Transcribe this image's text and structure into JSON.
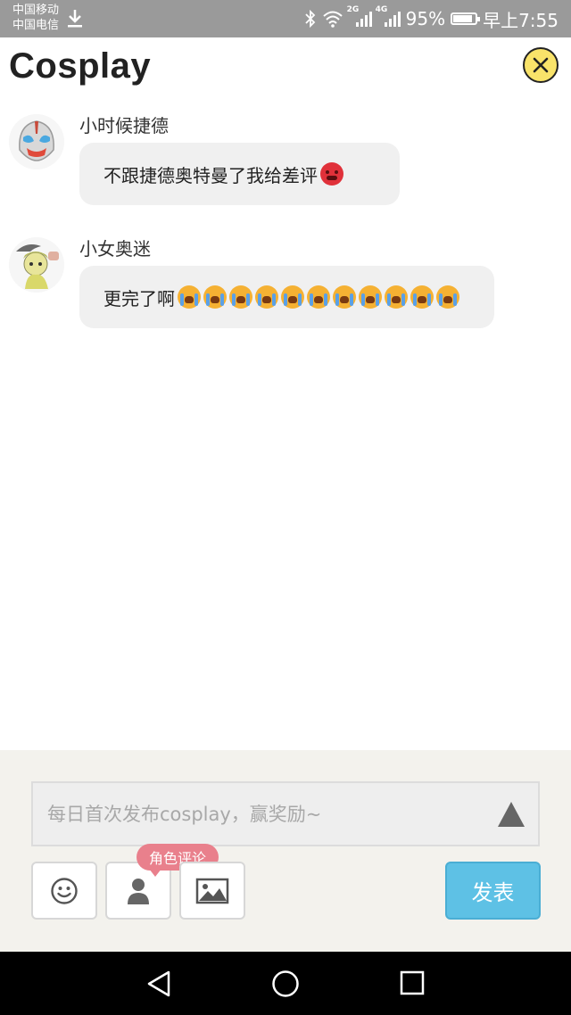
{
  "status_bar": {
    "carrier_1": "中国移动",
    "carrier_2": "中国电信",
    "net_1": "2G",
    "net_2": "4G",
    "battery_percent": "95%",
    "battery_level": 0.95,
    "time": "早上7:55"
  },
  "header": {
    "title": "Cosplay",
    "close_icon": "close-icon"
  },
  "messages": [
    {
      "username": "小时候捷德",
      "text": "不跟捷德奥特曼了我给差评",
      "emojis": [
        "angry-face"
      ]
    },
    {
      "username": "小女奥迷",
      "text": "更完了啊",
      "emojis": [
        "crying-face",
        "crying-face",
        "crying-face",
        "crying-face",
        "crying-face",
        "crying-face",
        "crying-face",
        "crying-face",
        "crying-face",
        "crying-face",
        "crying-face"
      ]
    }
  ],
  "composer": {
    "placeholder": "每日首次发布cosplay，赢奖励~",
    "role_tag": "角色评论",
    "send_label": "发表",
    "tools": [
      "smiley-icon",
      "person-icon",
      "image-icon"
    ]
  },
  "colors": {
    "status_bar": "#9a9a9a",
    "close_button": "#f9e36a",
    "send_button": "#5ec1e5",
    "role_tag": "#e9808c",
    "panel": "#f3f2ed",
    "bubble": "#f0f0f0"
  }
}
